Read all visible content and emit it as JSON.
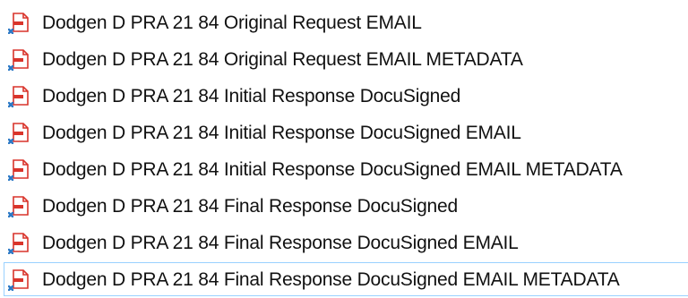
{
  "files": [
    {
      "name": "Dodgen D PRA 21 84 Original Request EMAIL",
      "icon": "pdf-file-icon"
    },
    {
      "name": "Dodgen D PRA 21 84 Original Request EMAIL METADATA",
      "icon": "pdf-file-icon"
    },
    {
      "name": "Dodgen D PRA 21 84 Initial Response DocuSigned",
      "icon": "pdf-file-icon"
    },
    {
      "name": "Dodgen D PRA 21 84 Initial Response DocuSigned EMAIL",
      "icon": "pdf-file-icon"
    },
    {
      "name": "Dodgen D PRA 21 84 Initial Response DocuSigned EMAIL METADATA",
      "icon": "pdf-file-icon"
    },
    {
      "name": "Dodgen D PRA 21 84 Final Response DocuSigned",
      "icon": "pdf-file-icon"
    },
    {
      "name": "Dodgen D PRA 21 84 Final Response DocuSigned EMAIL",
      "icon": "pdf-file-icon"
    },
    {
      "name": "Dodgen D PRA 21 84 Final Response DocuSigned EMAIL METADATA",
      "icon": "pdf-file-icon"
    }
  ],
  "colors": {
    "icon_red": "#d9342b",
    "icon_blue": "#2b78c5",
    "focus_border": "#99d1ff"
  }
}
